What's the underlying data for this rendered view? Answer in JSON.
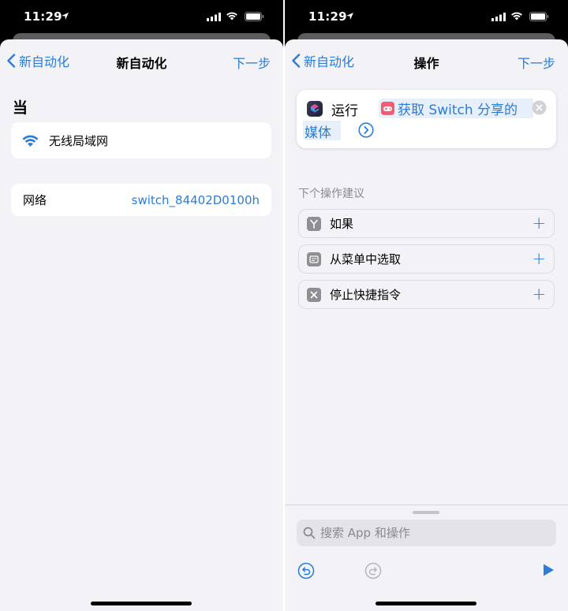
{
  "status_bar": {
    "time": "11:29"
  },
  "left_screen": {
    "nav": {
      "back_label": "新自动化",
      "title": "新自动化",
      "next_label": "下一步"
    },
    "when_heading": "当",
    "trigger": {
      "label": "无线局域网",
      "icon": "wifi-icon"
    },
    "network": {
      "label": "网络",
      "value": "switch_84402D0100h"
    }
  },
  "right_screen": {
    "nav": {
      "back_label": "新自动化",
      "title": "操作",
      "next_label": "下一步"
    },
    "action": {
      "run_label": "运行",
      "shortcut_name_line1": "获取 Switch 分享的",
      "shortcut_name_line2": "媒体"
    },
    "suggestions_heading": "下个操作建议",
    "suggestions": [
      {
        "label": "如果",
        "icon": "branch-icon"
      },
      {
        "label": "从菜单中选取",
        "icon": "menu-icon"
      },
      {
        "label": "停止快捷指令",
        "icon": "stop-icon"
      }
    ],
    "search": {
      "placeholder": "搜索 App 和操作"
    }
  },
  "colors": {
    "accent": "#2b7cd9",
    "background": "#f2f2f7",
    "game_icon": "#f25b73"
  }
}
